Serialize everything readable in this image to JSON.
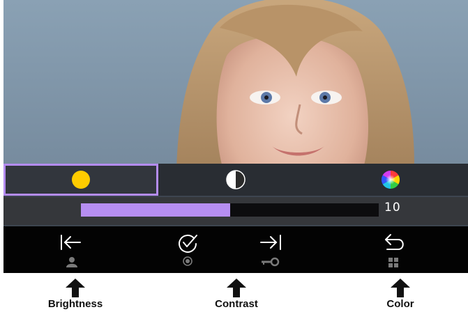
{
  "adjust_modes": [
    {
      "name": "brightness",
      "icon": "sun-dot-icon",
      "color": "#ffcc00",
      "selected": true
    },
    {
      "name": "contrast",
      "icon": "contrast-icon",
      "color": "#ffffff",
      "selected": false
    },
    {
      "name": "color",
      "icon": "color-wheel-icon",
      "color": "#ff44aa",
      "selected": false
    }
  ],
  "level": {
    "value": "10",
    "fill_fraction": 0.5,
    "fill_color": "#b68ef2"
  },
  "nav_buttons": [
    {
      "top_icon": "back-to-start-icon",
      "bottom_icon": "person-icon"
    },
    {
      "top_icon": "confirm-check-icon",
      "bottom_icon": "radio-dot-icon"
    },
    {
      "top_icon": "forward-to-end-icon",
      "bottom_icon": "key-icon"
    },
    {
      "top_icon": "return-arrow-icon",
      "bottom_icon": "grid-icon"
    }
  ],
  "annotations": {
    "brightness": "Brightness",
    "contrast": "Contrast",
    "color": "Color"
  },
  "colors": {
    "accent": "#b48cf0",
    "nav_bg": "#030303",
    "icon_gray": "#7a7a7a"
  }
}
